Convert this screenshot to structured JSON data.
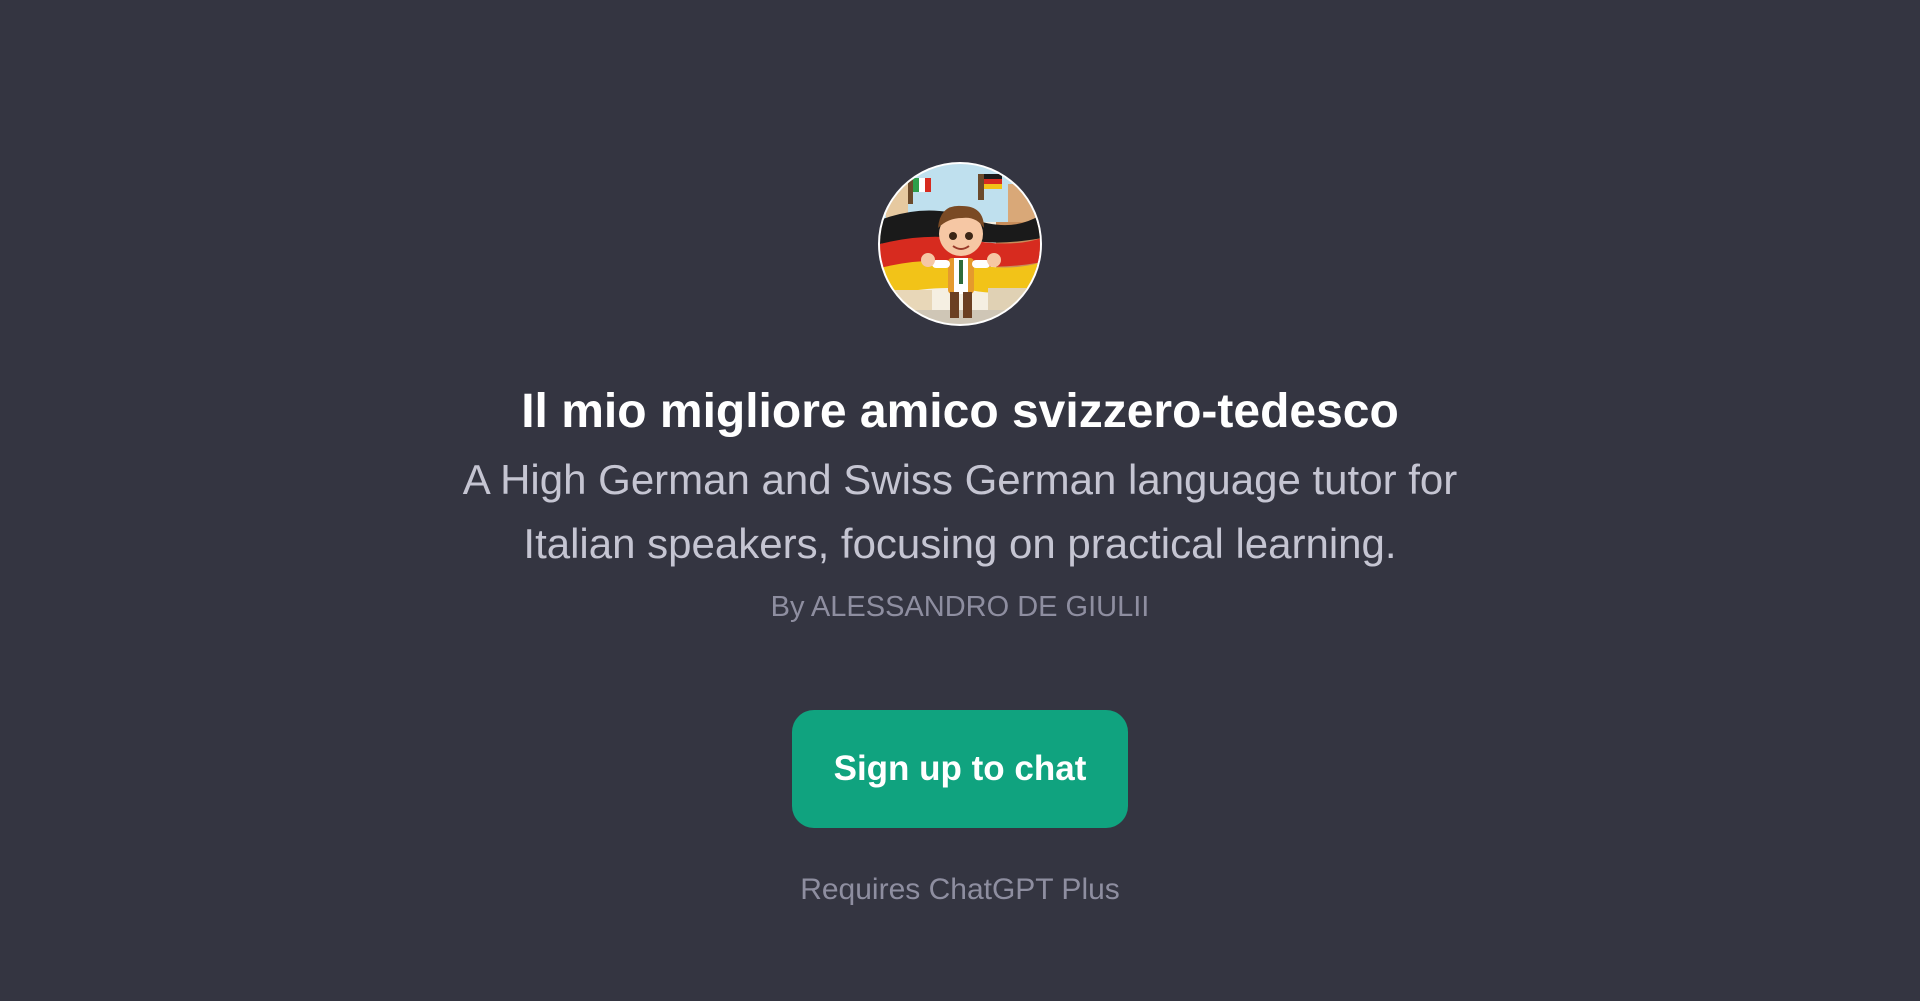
{
  "gpt": {
    "avatar_icon": "cartoon-boy-with-german-flag-avatar",
    "title": "Il mio migliore amico svizzero-tedesco",
    "description": "A High German and Swiss German language tutor for Italian speakers, focusing on practical learning.",
    "author": "By ALESSANDRO DE GIULII"
  },
  "cta": {
    "signup_label": "Sign up to chat",
    "requirement": "Requires ChatGPT Plus"
  },
  "colors": {
    "background": "#343541",
    "accent": "#10a37f",
    "title_text": "#ffffff",
    "description_text": "#c5c5d2",
    "muted_text": "#8e8ea0"
  }
}
